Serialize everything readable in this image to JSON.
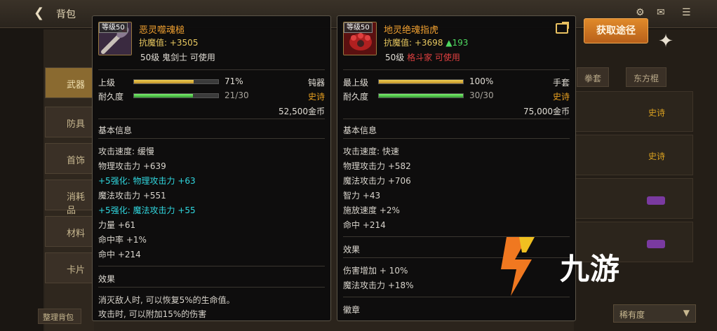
{
  "background": {
    "back_title": "背包",
    "tabs": [
      "武器",
      "防具",
      "首饰",
      "消耗品",
      "材料",
      "卡片"
    ],
    "col_headers": [
      "拳套",
      "东方棍"
    ],
    "epic_labels": [
      "史诗",
      "史诗"
    ],
    "bottom_left": "整理背包",
    "sort_select": "稀有度",
    "get_source_button": "获取途径"
  },
  "left_item": {
    "level_tag": "等级50",
    "name": "恶灵噬魂槌",
    "anti_magic": "抗魔值: +3505",
    "requirement": "50级 鬼剑士 可使用",
    "grade_label": "上级",
    "grade_percent": "71%",
    "grade_fill": 0.71,
    "durability_label": "耐久度",
    "durability": "21/30",
    "durability_fill": 0.7,
    "weapon_type": "钝器",
    "rarity": "史诗",
    "price": "52,500金币",
    "basic_info_title": "基本信息",
    "stats": [
      {
        "text": "攻击速度: 缓慢",
        "cyan": false
      },
      {
        "text": "物理攻击力 +639",
        "cyan": false
      },
      {
        "text": "+5强化: 物理攻击力 +63",
        "cyan": true
      },
      {
        "text": "魔法攻击力 +551",
        "cyan": false
      },
      {
        "text": "+5强化: 魔法攻击力 +55",
        "cyan": true
      },
      {
        "text": "力量 +61",
        "cyan": false
      },
      {
        "text": "命中率 +1%",
        "cyan": false
      },
      {
        "text": "命中 +214",
        "cyan": false
      }
    ],
    "effect_title": "效果",
    "effects": [
      "消灭敌人时, 可以恢复5%的生命值。",
      "攻击时, 可以附加15%的伤害"
    ]
  },
  "right_item": {
    "level_tag": "等级50",
    "name": "地灵绝魂指虎",
    "anti_magic_prefix": "抗魔值: +3698 ",
    "anti_magic_up": "▲193",
    "requirement_prefix": "50级 ",
    "requirement_class": "格斗家 可使用",
    "grade_label": "最上级",
    "grade_percent": "100%",
    "grade_fill": 1.0,
    "durability_label": "耐久度",
    "durability": "30/30",
    "durability_fill": 1.0,
    "weapon_type": "手套",
    "rarity": "史诗",
    "price": "75,000金币",
    "basic_info_title": "基本信息",
    "stats": [
      "攻击速度: 快速",
      "物理攻击力 +582",
      "魔法攻击力 +706",
      "智力 +43",
      "施放速度 +2%",
      "命中 +214"
    ],
    "effect_title": "效果",
    "effects": [
      "伤害增加 + 10%",
      "魔法攻击力 +18%"
    ],
    "emblem_title": "徽章"
  },
  "watermark": {
    "text": "九游"
  },
  "colors": {
    "epic": "#e8a020",
    "cyan": "#30d8e0",
    "orange_btn": "#d07020"
  }
}
